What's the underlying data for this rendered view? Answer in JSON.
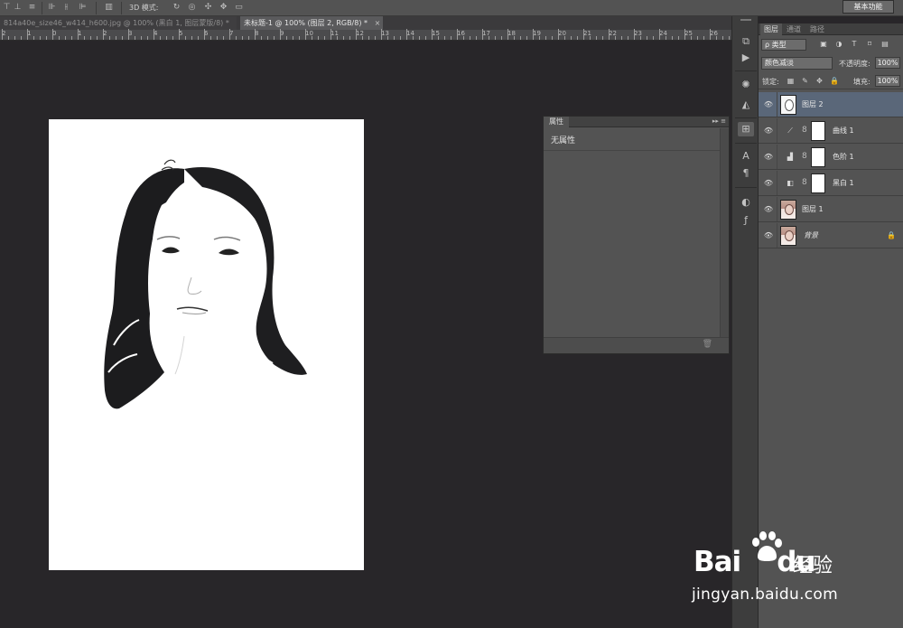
{
  "options_bar": {
    "mode_3d_label": "3D 模式:",
    "workspace_label": "基本功能"
  },
  "document_tabs": [
    {
      "title": "814a40e_size46_w414_h600.jpg @ 100% (黑白 1, 图层蒙版/8) *",
      "close": "×",
      "active": false
    },
    {
      "title": "未标题-1 @ 100% (图层 2, RGB/8) *",
      "close": "×",
      "active": true
    }
  ],
  "ruler": {
    "labels": [
      "2",
      "1",
      "0",
      "1",
      "2",
      "3",
      "4",
      "5",
      "6",
      "7",
      "8",
      "9",
      "10",
      "11",
      "12",
      "13",
      "14",
      "15",
      "16",
      "17",
      "18",
      "19",
      "20",
      "21",
      "22",
      "23",
      "24",
      "25",
      "26"
    ]
  },
  "properties_panel": {
    "title": "属性",
    "collapse_glyph": "▸▸",
    "menu_glyph": "≡",
    "content": "无属性",
    "trash_glyph": "🗑"
  },
  "dock_icons": [
    "history-icon",
    "play-icon",
    "navigator-icon",
    "histogram-icon",
    "layer-comps-icon",
    "character-icon",
    "paragraph-icon",
    "adjustments-icon",
    "styles-icon"
  ],
  "layers_panel": {
    "tabs": [
      {
        "label": "图层",
        "active": true
      },
      {
        "label": "通道",
        "active": false
      },
      {
        "label": "路径",
        "active": false
      }
    ],
    "filter_kind": "ρ 类型",
    "blend_mode": "颜色减淡",
    "opacity_label": "不透明度:",
    "opacity_value": "100%",
    "lock_label": "锁定:",
    "fill_label": "填充:",
    "fill_value": "100%",
    "layers": [
      {
        "name": "图层 2",
        "kind": "pixel",
        "thumb": "sketch",
        "selected": true,
        "visible": true
      },
      {
        "name": "曲线 1",
        "kind": "adjustment",
        "icon": "curves-icon",
        "selected": false,
        "visible": true
      },
      {
        "name": "色阶 1",
        "kind": "adjustment",
        "icon": "levels-icon",
        "selected": false,
        "visible": true
      },
      {
        "name": "黑白 1",
        "kind": "adjustment",
        "icon": "black-white-icon",
        "selected": false,
        "visible": true
      },
      {
        "name": "图层 1",
        "kind": "pixel",
        "thumb": "photo",
        "selected": false,
        "visible": true
      },
      {
        "name": "背景",
        "kind": "background",
        "thumb": "photo",
        "selected": false,
        "visible": true,
        "locked": true
      }
    ]
  },
  "watermark": {
    "brand": "Bai",
    "brand_du": "du",
    "product": "经验",
    "url": "jingyan.baidu.com"
  }
}
